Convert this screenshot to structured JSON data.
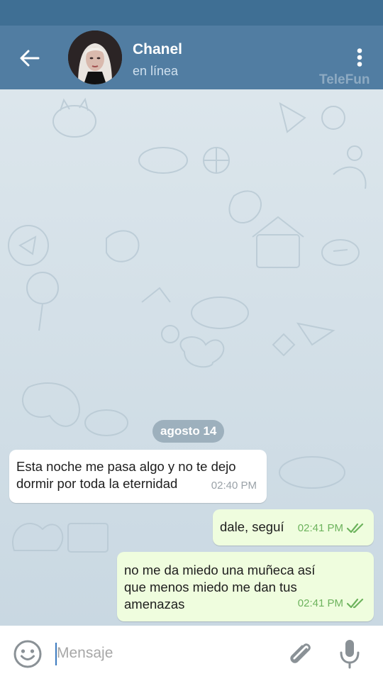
{
  "header": {
    "back_icon": "arrow-left-icon",
    "title": "Chanel",
    "status": "en línea",
    "menu_icon": "more-vertical-icon",
    "watermark": "TeleFun",
    "bg_color": "#517da2"
  },
  "chat": {
    "date_label": "agosto 14",
    "messages": [
      {
        "direction": "incoming",
        "text": "Esta noche me pasa algo y no te dejo\ndormir por toda la eternidad",
        "time": "02:40 PM"
      },
      {
        "direction": "outgoing",
        "text": "dale, seguí",
        "time": "02:41 PM",
        "status_icon": "double-check-icon"
      },
      {
        "direction": "outgoing",
        "text": "no me da miedo una muñeca así\nque menos miedo me dan tus\namenazas",
        "time": "02:41 PM",
        "status_icon": "double-check-icon"
      }
    ]
  },
  "composer": {
    "placeholder": "Mensaje",
    "emoji_icon": "smile-icon",
    "attach_icon": "paperclip-icon",
    "mic_icon": "microphone-icon"
  },
  "colors": {
    "incoming_bubble": "#ffffff",
    "outgoing_bubble": "#effdde",
    "check": "#6db35d"
  }
}
